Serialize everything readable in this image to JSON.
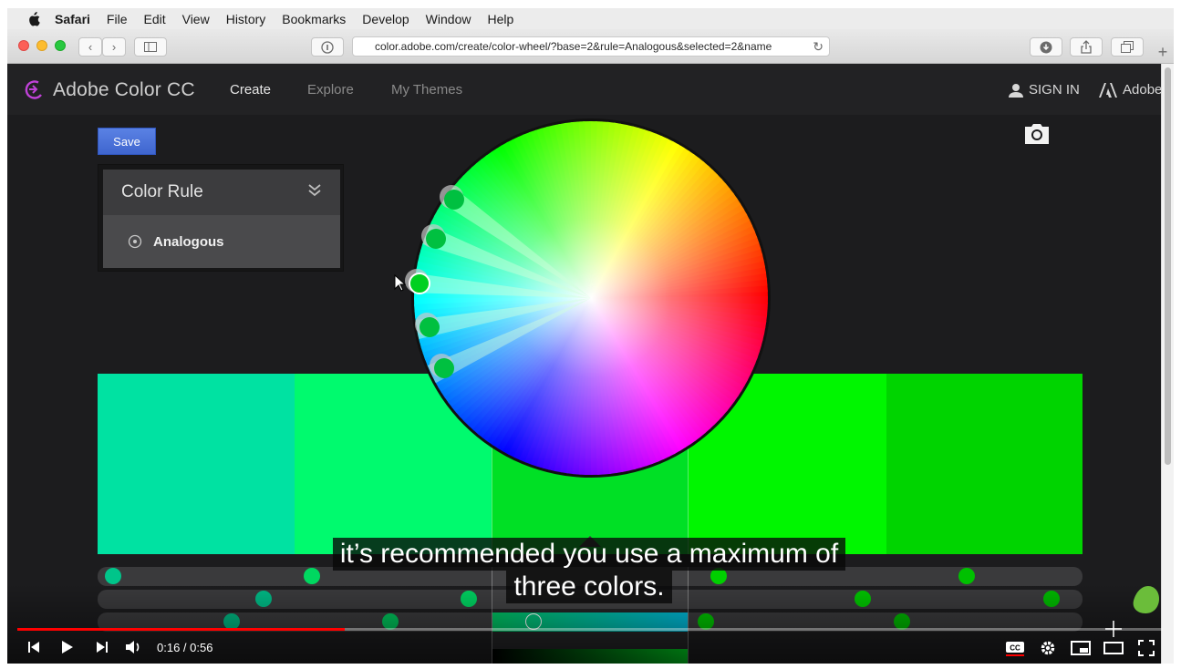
{
  "menubar": {
    "app_name": "Safari",
    "items": [
      "File",
      "Edit",
      "View",
      "History",
      "Bookmarks",
      "Develop",
      "Window",
      "Help"
    ]
  },
  "browser": {
    "url": "color.adobe.com/create/color-wheel/?base=2&rule=Analogous&selected=2&name"
  },
  "site": {
    "brand": "Adobe Color CC",
    "nav": [
      "Create",
      "Explore",
      "My Themes"
    ],
    "active_nav": "Create",
    "sign_in": "SIGN IN",
    "adobe_label": "Adobe"
  },
  "editor": {
    "save_label": "Save",
    "rule_title": "Color Rule",
    "rule_selected": "Analogous"
  },
  "swatches": {
    "colors": [
      "#00e2a2",
      "#00fa6e",
      "#00e025",
      "#00f600",
      "#00d400"
    ],
    "selected_index": 2
  },
  "video": {
    "caption_lines": [
      "it’s recommended you use a maximum of",
      "three colors."
    ],
    "time_label": "0:16 / 0:56",
    "progress_fraction": 0.2857
  },
  "icons": {
    "apple": "apple-icon",
    "camera": "camera-icon",
    "user": "user-icon",
    "chevron": "double-chevron-down-icon"
  }
}
